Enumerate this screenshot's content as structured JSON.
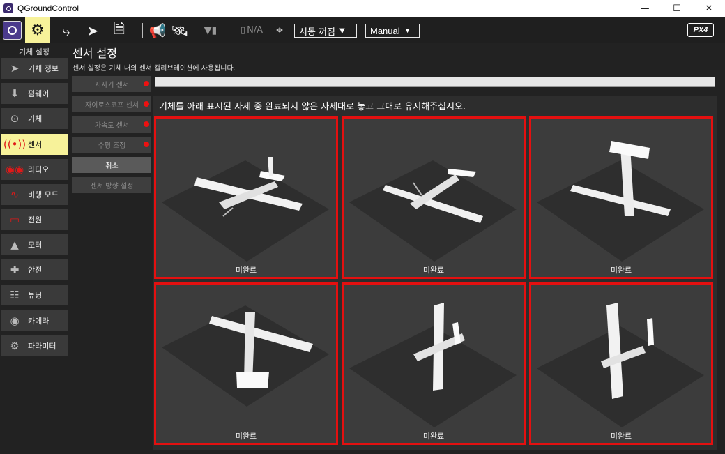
{
  "window": {
    "title": "QGroundControl"
  },
  "toolbar": {
    "battery_label": "N/A",
    "arm_dropdown": "시동 꺼짐",
    "mode_dropdown": "Manual",
    "brand": "PX4"
  },
  "sidebar": {
    "title": "기체 설정",
    "items": [
      {
        "label": "기체 정보",
        "icon": "paper-plane-icon"
      },
      {
        "label": "펌웨어",
        "icon": "download-icon"
      },
      {
        "label": "기체",
        "icon": "dots-circle-icon"
      },
      {
        "label": "센서",
        "icon": "radio-waves-icon",
        "active": true
      },
      {
        "label": "라디오",
        "icon": "rc-controller-icon"
      },
      {
        "label": "비행 모드",
        "icon": "waveform-icon"
      },
      {
        "label": "전원",
        "icon": "battery-icon"
      },
      {
        "label": "모터",
        "icon": "motor-icon"
      },
      {
        "label": "안전",
        "icon": "first-aid-kit-icon"
      },
      {
        "label": "튜닝",
        "icon": "sliders-icon"
      },
      {
        "label": "카메라",
        "icon": "camera-icon"
      },
      {
        "label": "파라미터",
        "icon": "gears-icon"
      }
    ]
  },
  "page": {
    "title": "센서 설정",
    "description": "센서 설정은 기체 내의 센서 캘리브레이션에 사용됩니다."
  },
  "sensor_buttons": [
    {
      "label": "지자기 센서",
      "needs_calibration": true
    },
    {
      "label": "자이로스코프 센서",
      "needs_calibration": true
    },
    {
      "label": "가속도 센서",
      "needs_calibration": true
    },
    {
      "label": "수평 조정",
      "needs_calibration": true
    },
    {
      "label": "취소",
      "enabled": true
    },
    {
      "label": "센서 방향 설정"
    }
  ],
  "calibration": {
    "progress": 0,
    "instruction": "기체를 아래 표시된 자세 중 완료되지 않은 자세대로 놓고 그대로 유지해주십시오.",
    "orientations": [
      {
        "status": "미완료"
      },
      {
        "status": "미완료"
      },
      {
        "status": "미완료"
      },
      {
        "status": "미완료"
      },
      {
        "status": "미완료"
      },
      {
        "status": "미완료"
      }
    ]
  },
  "colors": {
    "active_accent": "#f7f29a",
    "incomplete_border": "#e41010",
    "calibration_dot": "#ee1111"
  }
}
